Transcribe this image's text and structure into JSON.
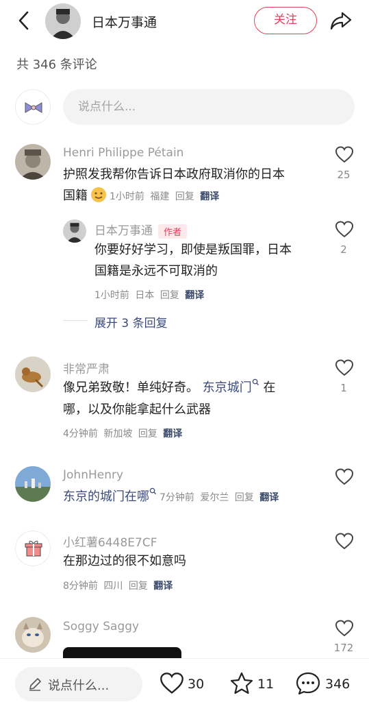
{
  "header": {
    "name": "日本万事通",
    "follow_label": "关注"
  },
  "comment_count_label": "共 346 条评论",
  "input_placeholder": "说点什么...",
  "comments": [
    {
      "name": "Henri Philippe Pétain",
      "text": "护照发我帮你告诉日本政府取消你的日本",
      "text2": "国籍",
      "time": "1小时前",
      "location": "福建",
      "reply": "回复",
      "translate": "翻译",
      "likes": "25"
    },
    {
      "name": "非常严肃",
      "text_a": "像兄弟致敬！单纯好奇。",
      "link": "东京城门",
      "text_b": "在",
      "text2": "哪，以及你能拿起什么武器",
      "time": "4分钟前",
      "location": "新加坡",
      "reply": "回复",
      "translate": "翻译",
      "likes": "1"
    },
    {
      "name": "JohnHenry",
      "link": "东京的城门在哪",
      "time": "7分钟前",
      "location": "爱尔兰",
      "reply": "回复",
      "translate": "翻译"
    },
    {
      "name": "小红薯6448E7CF",
      "text": "在那边过的很不如意吗",
      "time": "8分钟前",
      "location": "四川",
      "reply": "回复",
      "translate": "翻译"
    },
    {
      "name": "Soggy Saggy",
      "likes": "172"
    }
  ],
  "author_reply": {
    "name": "日本万事通",
    "badge": "作者",
    "text": "你要好好学习，即使是叛国罪，日本",
    "text2": "国籍是永远不可取消的",
    "time": "1小时前",
    "location": "日本",
    "reply": "回复",
    "translate": "翻译",
    "likes": "2"
  },
  "expand_label": "展开 3 条回复",
  "bottom_bar": {
    "placeholder": "说点什么...",
    "likes": "30",
    "stars": "11",
    "comments": "346"
  },
  "icons": [
    "back-icon",
    "share-icon",
    "heart-icon",
    "star-icon",
    "chat-icon",
    "pencil-icon",
    "gift-icon",
    "bow-icon"
  ],
  "colors": {
    "accent": "#e0405a",
    "link": "#3b4a7b"
  }
}
